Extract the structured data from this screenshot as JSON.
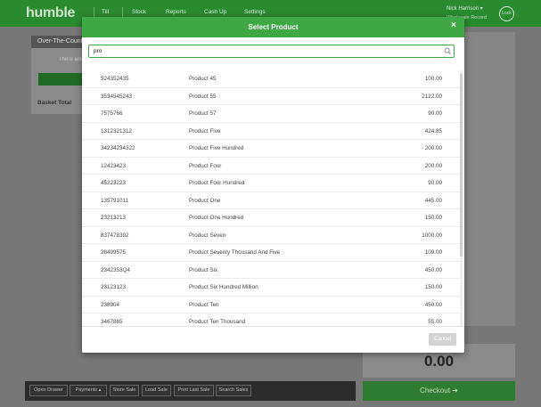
{
  "app": {
    "logo": "humble",
    "nav": [
      "Till",
      "Stock",
      "Reports",
      "Cash Up",
      "Settings"
    ],
    "user": "Nick Harrison ▾",
    "register": "Wholesale Record",
    "lock": "Lock"
  },
  "till": {
    "panel_title": "Over-The-Counter",
    "panel_message": "There are no items",
    "basket_total_label": "Basket Total",
    "total_value": "0.00",
    "toolbar_buttons": [
      "Open Drawer",
      "Payments ▴",
      "Store Sale",
      "Load Sale",
      "Print Last Sale",
      "Search Sales"
    ],
    "checkout_label": "Checkout ➔"
  },
  "modal": {
    "title": "Select Product",
    "close_label": "×",
    "search_value": "pro",
    "search_placeholder": "",
    "cancel_label": "Cancel",
    "rows": [
      {
        "code": "524352435",
        "name": "Product 45",
        "price": "100.00"
      },
      {
        "code": "3534545243",
        "name": "Product 55",
        "price": "2122.00"
      },
      {
        "code": "7575766",
        "name": "Product 57",
        "price": "90.00"
      },
      {
        "code": "1312321312",
        "name": "Product Five",
        "price": "424.85"
      },
      {
        "code": "34234234322",
        "name": "Product Five Hundred",
        "price": "200.00"
      },
      {
        "code": "12423423",
        "name": "Product Four",
        "price": "200.00"
      },
      {
        "code": "45223223",
        "name": "Product Four Hundred",
        "price": "90.00"
      },
      {
        "code": "135791011",
        "name": "Product One",
        "price": "445.00"
      },
      {
        "code": "23213213",
        "name": "Product One Hundred",
        "price": "150.00"
      },
      {
        "code": "837478392",
        "name": "Product Seven",
        "price": "1000.00"
      },
      {
        "code": "28499575",
        "name": "Product Seventy Thousand And Five",
        "price": "109.00"
      },
      {
        "code": "2342353Q4",
        "name": "Product Six",
        "price": "450.00"
      },
      {
        "code": "23123123",
        "name": "Product Six Hundred Million",
        "price": "150.00"
      },
      {
        "code": "238904",
        "name": "Product Ten",
        "price": "450.00"
      },
      {
        "code": "3467865",
        "name": "Product Ten Thousand",
        "price": "55.00"
      }
    ]
  }
}
